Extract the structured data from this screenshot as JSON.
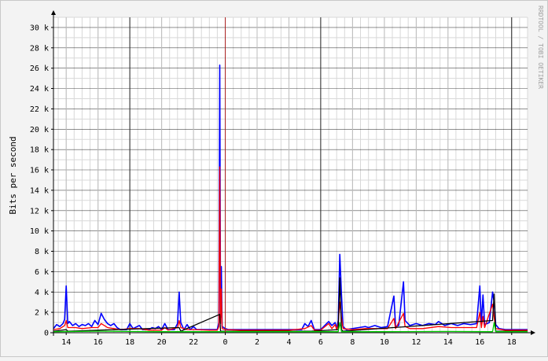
{
  "chart_data": {
    "type": "line",
    "title": "",
    "xlabel": "",
    "ylabel": "Bits per second",
    "watermark": "RRDTOOL / TOBI OETIKER",
    "x_unit": "hour of day",
    "x_start_hour": 13.2,
    "x_end_hour": 43.0,
    "x_tick_labels": [
      {
        "hour": 14,
        "label": "14"
      },
      {
        "hour": 16,
        "label": "16"
      },
      {
        "hour": 18,
        "label": "18"
      },
      {
        "hour": 20,
        "label": "20"
      },
      {
        "hour": 22,
        "label": "22"
      },
      {
        "hour": 24,
        "label": "0"
      },
      {
        "hour": 26,
        "label": "2"
      },
      {
        "hour": 28,
        "label": "4"
      },
      {
        "hour": 30,
        "label": "6"
      },
      {
        "hour": 32,
        "label": "8"
      },
      {
        "hour": 34,
        "label": "10"
      },
      {
        "hour": 36,
        "label": "12"
      },
      {
        "hour": 38,
        "label": "14"
      },
      {
        "hour": 40,
        "label": "16"
      },
      {
        "hour": 42,
        "label": "18"
      }
    ],
    "major_x_hours": [
      18,
      30,
      42
    ],
    "day_boundary_hour": 24,
    "ylim": [
      0,
      31000
    ],
    "y_ticks": [
      0,
      2000,
      4000,
      6000,
      8000,
      10000,
      12000,
      14000,
      16000,
      18000,
      20000,
      22000,
      24000,
      26000,
      28000,
      30000
    ],
    "y_tick_labels": [
      "0",
      "2 k",
      "4 k",
      "6 k",
      "8 k",
      "10 k",
      "12 k",
      "14 k",
      "16 k",
      "18 k",
      "20 k",
      "22 k",
      "24 k",
      "26 k",
      "28 k",
      "30 k"
    ],
    "grid": true,
    "colors": {
      "blue": "#0000ff",
      "red": "#ff0000",
      "green": "#00cc00",
      "dark": "#000000",
      "day_line": "#aa2222",
      "major_grid": "#000000",
      "minor_grid": "#d8d8d8",
      "plot_bg": "#ffffff",
      "page_bg": "#f3f3f3"
    },
    "series": [
      {
        "color": "blue",
        "points": [
          [
            13.2,
            400
          ],
          [
            13.4,
            800
          ],
          [
            13.6,
            600
          ],
          [
            13.8,
            900
          ],
          [
            13.9,
            1300
          ],
          [
            14.0,
            4600
          ],
          [
            14.1,
            900
          ],
          [
            14.2,
            1100
          ],
          [
            14.4,
            700
          ],
          [
            14.6,
            900
          ],
          [
            14.8,
            600
          ],
          [
            15.0,
            800
          ],
          [
            15.2,
            700
          ],
          [
            15.4,
            900
          ],
          [
            15.6,
            600
          ],
          [
            15.8,
            1200
          ],
          [
            16.0,
            800
          ],
          [
            16.2,
            1900
          ],
          [
            16.4,
            1300
          ],
          [
            16.6,
            900
          ],
          [
            16.8,
            700
          ],
          [
            17.0,
            900
          ],
          [
            17.2,
            500
          ],
          [
            17.4,
            300
          ],
          [
            17.8,
            300
          ],
          [
            18.0,
            900
          ],
          [
            18.2,
            400
          ],
          [
            18.6,
            700
          ],
          [
            18.8,
            300
          ],
          [
            19.2,
            300
          ],
          [
            19.4,
            500
          ],
          [
            19.6,
            400
          ],
          [
            19.8,
            600
          ],
          [
            20.0,
            300
          ],
          [
            20.2,
            900
          ],
          [
            20.4,
            300
          ],
          [
            20.8,
            300
          ],
          [
            21.0,
            900
          ],
          [
            21.1,
            4000
          ],
          [
            21.2,
            1000
          ],
          [
            21.4,
            300
          ],
          [
            21.6,
            800
          ],
          [
            21.8,
            300
          ],
          [
            22.0,
            600
          ],
          [
            22.2,
            300
          ],
          [
            22.6,
            300
          ],
          [
            23.0,
            300
          ],
          [
            23.5,
            300
          ],
          [
            23.6,
            1000
          ],
          [
            23.65,
            26300
          ],
          [
            23.7,
            1500
          ],
          [
            23.75,
            6500
          ],
          [
            23.8,
            600
          ],
          [
            24.0,
            400
          ],
          [
            24.2,
            300
          ],
          [
            25.0,
            300
          ],
          [
            26.0,
            300
          ],
          [
            27.0,
            300
          ],
          [
            28.0,
            300
          ],
          [
            28.8,
            300
          ],
          [
            29.0,
            900
          ],
          [
            29.2,
            600
          ],
          [
            29.4,
            1200
          ],
          [
            29.6,
            300
          ],
          [
            30.0,
            300
          ],
          [
            30.5,
            1100
          ],
          [
            30.7,
            700
          ],
          [
            30.9,
            1000
          ],
          [
            31.0,
            400
          ],
          [
            31.1,
            1200
          ],
          [
            31.2,
            7700
          ],
          [
            31.3,
            3800
          ],
          [
            31.4,
            600
          ],
          [
            31.6,
            300
          ],
          [
            32.0,
            400
          ],
          [
            32.4,
            500
          ],
          [
            32.8,
            600
          ],
          [
            33.0,
            500
          ],
          [
            33.4,
            700
          ],
          [
            33.8,
            500
          ],
          [
            34.2,
            600
          ],
          [
            34.6,
            3600
          ],
          [
            34.7,
            600
          ],
          [
            34.9,
            700
          ],
          [
            35.2,
            5000
          ],
          [
            35.3,
            1200
          ],
          [
            35.6,
            700
          ],
          [
            36.0,
            900
          ],
          [
            36.4,
            700
          ],
          [
            36.8,
            900
          ],
          [
            37.2,
            800
          ],
          [
            37.4,
            1100
          ],
          [
            37.8,
            700
          ],
          [
            38.2,
            900
          ],
          [
            38.6,
            700
          ],
          [
            39.0,
            900
          ],
          [
            39.4,
            800
          ],
          [
            39.8,
            900
          ],
          [
            40.0,
            4600
          ],
          [
            40.1,
            900
          ],
          [
            40.2,
            3700
          ],
          [
            40.3,
            800
          ],
          [
            40.6,
            1000
          ],
          [
            40.8,
            4000
          ],
          [
            40.9,
            3000
          ],
          [
            41.0,
            800
          ],
          [
            41.2,
            400
          ],
          [
            41.6,
            300
          ],
          [
            42.0,
            300
          ],
          [
            42.5,
            300
          ],
          [
            43.0,
            300
          ]
        ]
      },
      {
        "color": "red",
        "points": [
          [
            13.2,
            300
          ],
          [
            13.6,
            400
          ],
          [
            13.9,
            700
          ],
          [
            14.0,
            1200
          ],
          [
            14.1,
            500
          ],
          [
            14.6,
            500
          ],
          [
            15.0,
            400
          ],
          [
            15.6,
            500
          ],
          [
            16.0,
            500
          ],
          [
            16.2,
            900
          ],
          [
            16.4,
            700
          ],
          [
            16.6,
            500
          ],
          [
            17.0,
            400
          ],
          [
            17.4,
            300
          ],
          [
            18.0,
            400
          ],
          [
            18.6,
            400
          ],
          [
            19.2,
            250
          ],
          [
            20.0,
            250
          ],
          [
            20.2,
            500
          ],
          [
            20.4,
            250
          ],
          [
            21.0,
            500
          ],
          [
            21.1,
            1200
          ],
          [
            21.2,
            500
          ],
          [
            21.6,
            300
          ],
          [
            22.0,
            300
          ],
          [
            23.0,
            250
          ],
          [
            23.5,
            250
          ],
          [
            23.6,
            600
          ],
          [
            23.65,
            16300
          ],
          [
            23.7,
            900
          ],
          [
            23.75,
            4300
          ],
          [
            23.8,
            400
          ],
          [
            24.0,
            300
          ],
          [
            25.0,
            250
          ],
          [
            26.0,
            250
          ],
          [
            27.0,
            250
          ],
          [
            28.0,
            250
          ],
          [
            29.0,
            400
          ],
          [
            29.4,
            700
          ],
          [
            29.6,
            250
          ],
          [
            30.0,
            250
          ],
          [
            30.5,
            900
          ],
          [
            30.7,
            400
          ],
          [
            30.9,
            800
          ],
          [
            31.0,
            300
          ],
          [
            31.1,
            900
          ],
          [
            31.2,
            3000
          ],
          [
            31.3,
            1500
          ],
          [
            31.4,
            400
          ],
          [
            32.0,
            300
          ],
          [
            32.8,
            400
          ],
          [
            33.4,
            400
          ],
          [
            34.2,
            400
          ],
          [
            34.6,
            1400
          ],
          [
            34.7,
            400
          ],
          [
            35.2,
            1900
          ],
          [
            35.3,
            600
          ],
          [
            35.6,
            400
          ],
          [
            36.4,
            400
          ],
          [
            37.4,
            600
          ],
          [
            38.2,
            500
          ],
          [
            39.0,
            500
          ],
          [
            39.8,
            500
          ],
          [
            40.0,
            2000
          ],
          [
            40.1,
            500
          ],
          [
            40.2,
            1600
          ],
          [
            40.3,
            500
          ],
          [
            40.8,
            2800
          ],
          [
            40.9,
            1500
          ],
          [
            41.0,
            400
          ],
          [
            41.6,
            250
          ],
          [
            43.0,
            250
          ]
        ]
      },
      {
        "color": "dark",
        "points": [
          [
            13.2,
            150
          ],
          [
            14.0,
            300
          ],
          [
            14.1,
            150
          ],
          [
            21.1,
            500
          ],
          [
            21.2,
            150
          ],
          [
            23.65,
            1800
          ],
          [
            23.7,
            150
          ],
          [
            29.4,
            150
          ],
          [
            31.1,
            300
          ],
          [
            31.2,
            5400
          ],
          [
            31.3,
            300
          ],
          [
            31.4,
            150
          ],
          [
            40.8,
            1200
          ],
          [
            40.9,
            3800
          ],
          [
            41.0,
            150
          ],
          [
            43.0,
            150
          ]
        ]
      },
      {
        "color": "green",
        "points": [
          [
            13.2,
            100
          ],
          [
            16.0,
            150
          ],
          [
            20.0,
            100
          ],
          [
            24.0,
            100
          ],
          [
            28.0,
            100
          ],
          [
            31.1,
            100
          ],
          [
            31.2,
            1000
          ],
          [
            31.3,
            100
          ],
          [
            34.0,
            100
          ],
          [
            38.0,
            120
          ],
          [
            40.8,
            100
          ],
          [
            40.9,
            1000
          ],
          [
            41.0,
            100
          ],
          [
            43.0,
            100
          ]
        ]
      }
    ]
  }
}
